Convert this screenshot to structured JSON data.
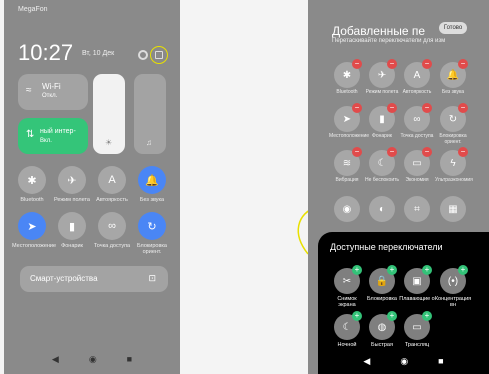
{
  "left": {
    "carrier": "MegaFon",
    "time": "10:27",
    "date": "Вт, 10 Дек",
    "wifi": {
      "title": "Wi-Fi",
      "state": "Откл."
    },
    "mobile": {
      "title": "ный интер-",
      "state": "Вкл."
    },
    "tiles": [
      {
        "label": "Bluetooth",
        "icon": "✱"
      },
      {
        "label": "Режим полета",
        "icon": "✈"
      },
      {
        "label": "Автояркость",
        "icon": "A"
      },
      {
        "label": "Без звука",
        "icon": "🔔"
      },
      {
        "label": "Местоположение",
        "icon": "➤"
      },
      {
        "label": "Фонарик",
        "icon": "▮"
      },
      {
        "label": "Точка доступа",
        "icon": "∞"
      },
      {
        "label": "Блокировка ориент.",
        "icon": "↻"
      }
    ],
    "smart": "Смарт-устройства"
  },
  "right": {
    "header": "Добавленные пе",
    "subheader": "Перетаскивайте переключатели для изм",
    "ready": "Готово",
    "tiles": [
      {
        "label": "Bluetooth",
        "icon": "✱"
      },
      {
        "label": "Режим полета",
        "icon": "✈"
      },
      {
        "label": "Автояркость",
        "icon": "A"
      },
      {
        "label": "Без звука",
        "icon": "🔔"
      },
      {
        "label": "Местоположение",
        "icon": "➤"
      },
      {
        "label": "Фонарик",
        "icon": "▮"
      },
      {
        "label": "Точка доступа",
        "icon": "∞"
      },
      {
        "label": "Блокировка ориент.",
        "icon": "↻"
      },
      {
        "label": "Вибрация",
        "icon": "≋"
      },
      {
        "label": "Не беспокоить",
        "icon": "☾"
      },
      {
        "label": "Экономия",
        "icon": "▭"
      },
      {
        "label": "Ультраэкономия",
        "icon": "ϟ"
      },
      {
        "label": "",
        "icon": "◉"
      },
      {
        "label": "",
        "icon": "◐"
      },
      {
        "label": "",
        "icon": "⌗"
      },
      {
        "label": "",
        "icon": "▦"
      }
    ],
    "panel_title": "Доступные переключатели",
    "available": [
      {
        "label": "Снимок экрана",
        "icon": "✂"
      },
      {
        "label": "Блокировка",
        "icon": "🔒"
      },
      {
        "label": "Плавающие о",
        "icon": "▣"
      },
      {
        "label": "Концентрация вн",
        "icon": "(•)"
      },
      {
        "label": "Ночной",
        "icon": "☾"
      },
      {
        "label": "Быстрая",
        "icon": "◍"
      },
      {
        "label": "Трансляц",
        "icon": "▭"
      }
    ]
  },
  "colors": {
    "accent": "#4a86f5",
    "green": "#34c579",
    "remove": "#e14b4b",
    "highlight": "#e8e000"
  }
}
